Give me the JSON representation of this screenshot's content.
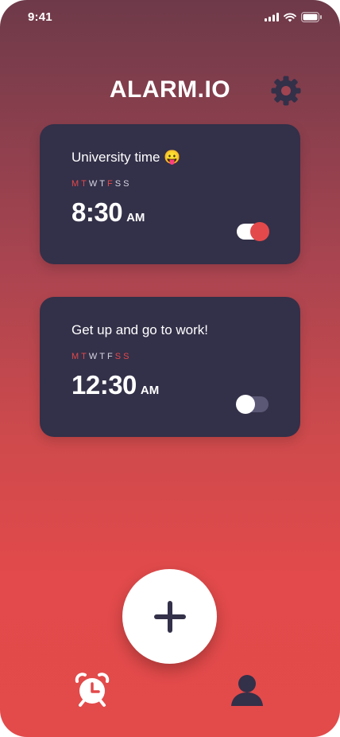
{
  "status_bar": {
    "time": "9:41"
  },
  "header": {
    "title": "ALARM.IO"
  },
  "alarms": [
    {
      "name": "University time 😛",
      "days": [
        {
          "label": "M",
          "active": true
        },
        {
          "label": "T",
          "active": true
        },
        {
          "label": "W",
          "active": false
        },
        {
          "label": "T",
          "active": false
        },
        {
          "label": "F",
          "active": true
        },
        {
          "label": "S",
          "active": false
        },
        {
          "label": "S",
          "active": false
        }
      ],
      "time": "8:30",
      "period": "AM",
      "enabled": true
    },
    {
      "name": "Get up and go to work!",
      "days": [
        {
          "label": "M",
          "active": true
        },
        {
          "label": "T",
          "active": true
        },
        {
          "label": "W",
          "active": false
        },
        {
          "label": "T",
          "active": false
        },
        {
          "label": "F",
          "active": false
        },
        {
          "label": "S",
          "active": true
        },
        {
          "label": "S",
          "active": true
        }
      ],
      "time": "12:30",
      "period": "AM",
      "enabled": false
    }
  ],
  "icons": {
    "settings": "gear-icon",
    "add": "plus-icon",
    "nav_alarm": "alarm-clock-icon",
    "nav_profile": "user-icon"
  },
  "colors": {
    "accent": "#e3494b",
    "card": "#333049",
    "gradient_top": "#6e3a4a",
    "gradient_bottom": "#e34a4a"
  }
}
